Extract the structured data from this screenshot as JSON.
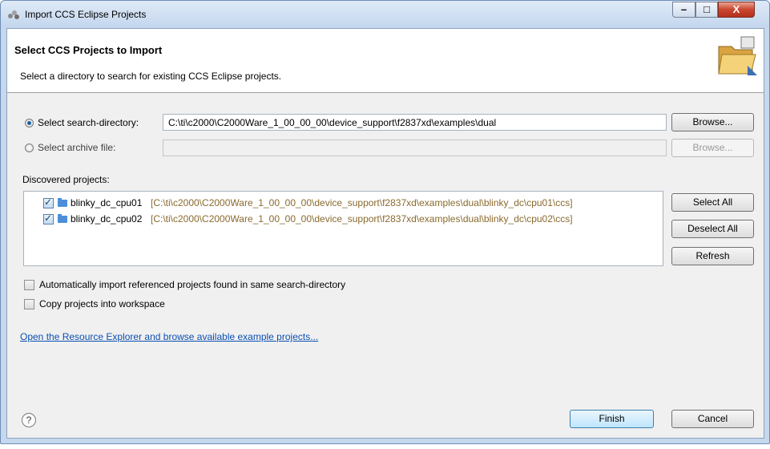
{
  "window": {
    "title": "Import CCS Eclipse Projects",
    "controls": {
      "minimize": "–",
      "maximize": "□",
      "close": "X"
    }
  },
  "header": {
    "title": "Select CCS Projects to Import",
    "description": "Select a directory to search for existing CCS Eclipse projects.",
    "icon": "import-folder-icon"
  },
  "source": {
    "search_dir_label": "Select search-directory:",
    "search_dir_value": "C:\\ti\\c2000\\C2000Ware_1_00_00_00\\device_support\\f2837xd\\examples\\dual",
    "search_dir_selected": true,
    "browse_label": "Browse...",
    "archive_label": "Select archive file:",
    "archive_value": "",
    "archive_browse_label": "Browse..."
  },
  "discovered": {
    "label": "Discovered projects:",
    "projects": [
      {
        "name": "blinky_dc_cpu01",
        "path": "[C:\\ti\\c2000\\C2000Ware_1_00_00_00\\device_support\\f2837xd\\examples\\dual\\blinky_dc\\cpu01\\ccs]",
        "checked": true
      },
      {
        "name": "blinky_dc_cpu02",
        "path": "[C:\\ti\\c2000\\C2000Ware_1_00_00_00\\device_support\\f2837xd\\examples\\dual\\blinky_dc\\cpu02\\ccs]",
        "checked": true
      }
    ],
    "select_all_label": "Select All",
    "deselect_all_label": "Deselect All",
    "refresh_label": "Refresh"
  },
  "options": {
    "auto_import_label": "Automatically import referenced projects found in same search-directory",
    "auto_import_checked": false,
    "copy_label": "Copy projects into workspace",
    "copy_checked": false
  },
  "link_text": "Open the Resource Explorer and browse available example projects...",
  "footer": {
    "help": "?",
    "finish_label": "Finish",
    "cancel_label": "Cancel"
  },
  "colors": {
    "accent": "#0b4fb3",
    "path_text": "#8a6a2e",
    "titlebar": "#c3d6ee"
  }
}
